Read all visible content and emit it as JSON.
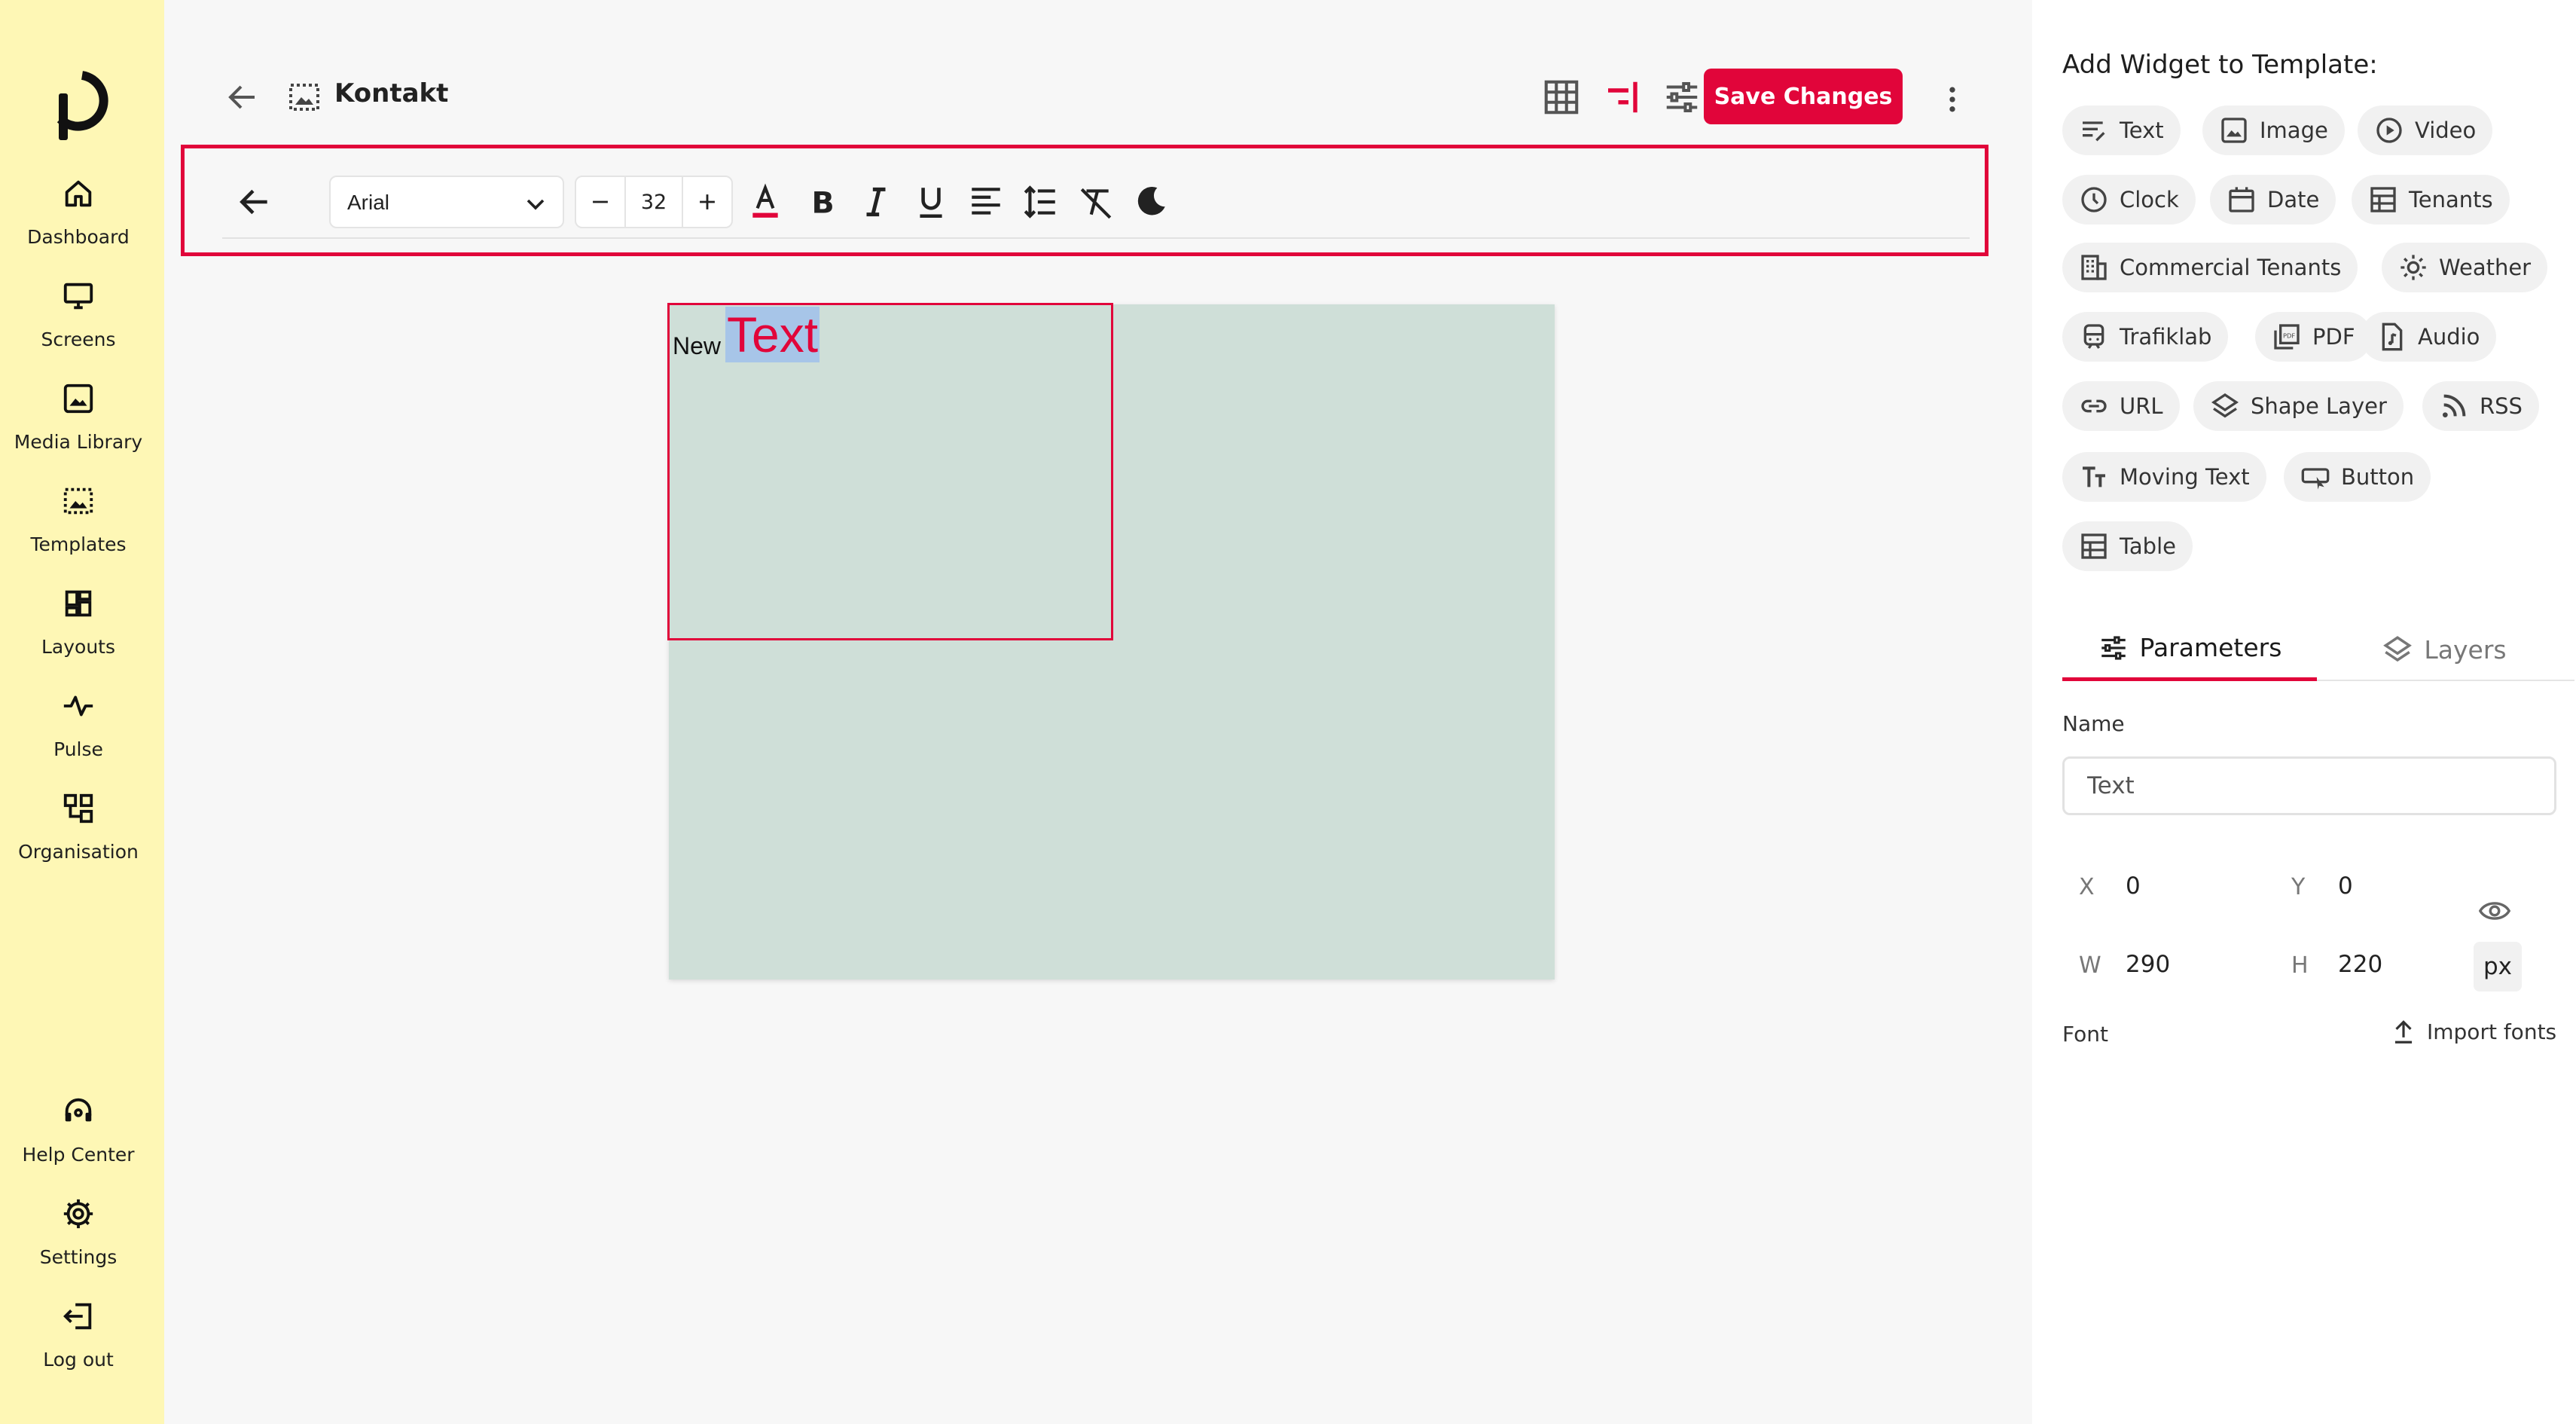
{
  "sidebar": {
    "items": [
      {
        "label": "Dashboard",
        "icon": "home-icon"
      },
      {
        "label": "Screens",
        "icon": "monitor-icon"
      },
      {
        "label": "Media Library",
        "icon": "image-icon"
      },
      {
        "label": "Templates",
        "icon": "template-icon"
      },
      {
        "label": "Layouts",
        "icon": "layout-icon"
      },
      {
        "label": "Pulse",
        "icon": "pulse-icon"
      },
      {
        "label": "Organisation",
        "icon": "organisation-icon"
      }
    ],
    "bottom_items": [
      {
        "label": "Help Center",
        "icon": "headset-icon"
      },
      {
        "label": "Settings",
        "icon": "gear-icon"
      },
      {
        "label": "Log out",
        "icon": "logout-icon"
      }
    ]
  },
  "header": {
    "title": "Kontakt",
    "save_label": "Save Changes"
  },
  "format_toolbar": {
    "font_family": "Arial",
    "font_size": "32"
  },
  "canvas": {
    "word1": "New",
    "word2": "Text"
  },
  "widgets": {
    "title": "Add Widget to Template:",
    "items": [
      "Text",
      "Image",
      "Video",
      "Clock",
      "Date",
      "Tenants",
      "Commercial Tenants",
      "Weather",
      "Trafiklab",
      "PDF",
      "Audio",
      "URL",
      "Shape Layer",
      "RSS",
      "Moving Text",
      "Button",
      "Table"
    ]
  },
  "panel": {
    "tabs": [
      "Parameters",
      "Layers"
    ],
    "name_label": "Name",
    "name_value": "Text",
    "x_label": "X",
    "x_value": "0",
    "y_label": "Y",
    "y_value": "0",
    "w_label": "W",
    "w_value": "290",
    "h_label": "H",
    "h_value": "220",
    "unit": "px",
    "font_label": "Font",
    "import_fonts": "Import fonts"
  },
  "colors": {
    "accent": "#e1053a",
    "sidebar_bg": "#fef7b5",
    "canvas_bg": "#cfdfd8",
    "selection": "#a7c5e8"
  }
}
